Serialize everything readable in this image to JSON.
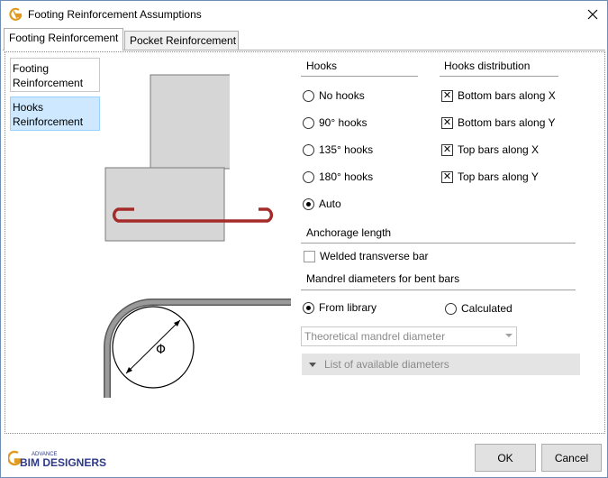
{
  "window": {
    "title": "Footing Reinforcement Assumptions"
  },
  "tabs": [
    {
      "label": "Footing Reinforcement",
      "active": true
    },
    {
      "label": "Pocket Reinforcement",
      "active": false
    }
  ],
  "side_menu": [
    {
      "label_line1": "Footing",
      "label_line2": "Reinforcement",
      "selected": false
    },
    {
      "label_line1": "Hooks",
      "label_line2": "Reinforcement",
      "selected": true
    }
  ],
  "hooks": {
    "title": "Hooks",
    "options": [
      {
        "label": "No hooks",
        "selected": false
      },
      {
        "label": "90° hooks",
        "selected": false
      },
      {
        "label": "135° hooks",
        "selected": false
      },
      {
        "label": "180° hooks",
        "selected": false
      },
      {
        "label": "Auto",
        "selected": true
      }
    ]
  },
  "hooks_distribution": {
    "title": "Hooks distribution",
    "items": [
      {
        "label": "Bottom bars along X",
        "checked": true
      },
      {
        "label": "Bottom bars along Y",
        "checked": true
      },
      {
        "label": "Top bars along X",
        "checked": true
      },
      {
        "label": "Top bars along Y",
        "checked": true
      }
    ]
  },
  "anchorage": {
    "title": "Anchorage length",
    "welded_label": "Welded transverse bar",
    "welded_checked": false
  },
  "mandrel": {
    "title": "Mandrel diameters for bent bars",
    "from_library_label": "From library",
    "calculated_label": "Calculated",
    "selected": "from_library",
    "combo_value": "Theoretical mandrel diameter",
    "list_label": "List of available diameters"
  },
  "drawing": {
    "diameter_symbol": "Φ",
    "rebar_color": "#a52a2a"
  },
  "footer": {
    "logo_small": "ADVANCE",
    "logo_main": "BIM DESIGNERS",
    "ok_label": "OK",
    "cancel_label": "Cancel"
  },
  "colors": {
    "accent": "#0078d7",
    "selected_bg": "#cde8ff",
    "logo": "#2e3a87"
  }
}
